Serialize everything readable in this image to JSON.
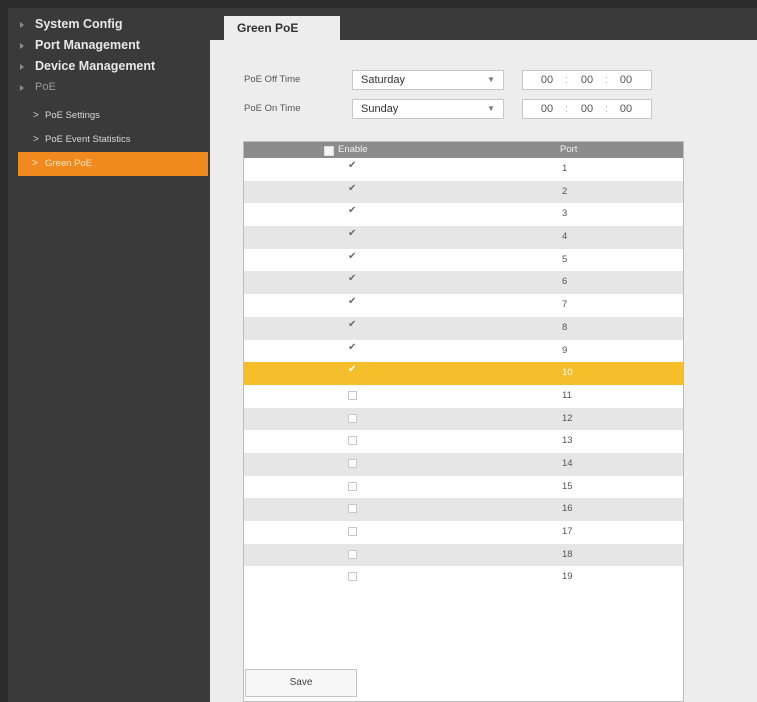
{
  "sidebar": {
    "items": [
      {
        "label": "System Config"
      },
      {
        "label": "Port Management"
      },
      {
        "label": "Device Management"
      },
      {
        "label": "PoE"
      }
    ],
    "sub_items": [
      {
        "label": "PoE Settings"
      },
      {
        "label": "PoE Event Statistics"
      },
      {
        "label": "Green PoE"
      }
    ]
  },
  "tab": {
    "label": "Green PoE"
  },
  "form": {
    "off_time": {
      "label": "PoE Off Time",
      "day": "Saturday",
      "hh": "00",
      "mm": "00",
      "ss": "00"
    },
    "on_time": {
      "label": "PoE On Time",
      "day": "Sunday",
      "hh": "00",
      "mm": "00",
      "ss": "00"
    }
  },
  "table": {
    "headers": {
      "enable": "Enable",
      "port": "Port"
    },
    "rows": [
      {
        "port": "1",
        "enabled": true
      },
      {
        "port": "2",
        "enabled": true
      },
      {
        "port": "3",
        "enabled": true
      },
      {
        "port": "4",
        "enabled": true
      },
      {
        "port": "5",
        "enabled": true
      },
      {
        "port": "6",
        "enabled": true
      },
      {
        "port": "7",
        "enabled": true
      },
      {
        "port": "8",
        "enabled": true
      },
      {
        "port": "9",
        "enabled": true
      },
      {
        "port": "10",
        "enabled": true,
        "selected": true
      },
      {
        "port": "11",
        "enabled": false
      },
      {
        "port": "12",
        "enabled": false
      },
      {
        "port": "13",
        "enabled": false
      },
      {
        "port": "14",
        "enabled": false
      },
      {
        "port": "15",
        "enabled": false
      },
      {
        "port": "16",
        "enabled": false
      },
      {
        "port": "17",
        "enabled": false
      },
      {
        "port": "18",
        "enabled": false
      },
      {
        "port": "19",
        "enabled": false
      }
    ]
  },
  "buttons": {
    "save": "Save"
  },
  "colors": {
    "accent": "#f08a1e",
    "selected_row": "#f5bf2c",
    "sidebar_bg": "#3a3a3a"
  },
  "icons": {
    "nav_bullet": "triangle-right-icon",
    "sub_bullet": "chevron-right-icon",
    "checkbox": "checkmark-icon"
  }
}
